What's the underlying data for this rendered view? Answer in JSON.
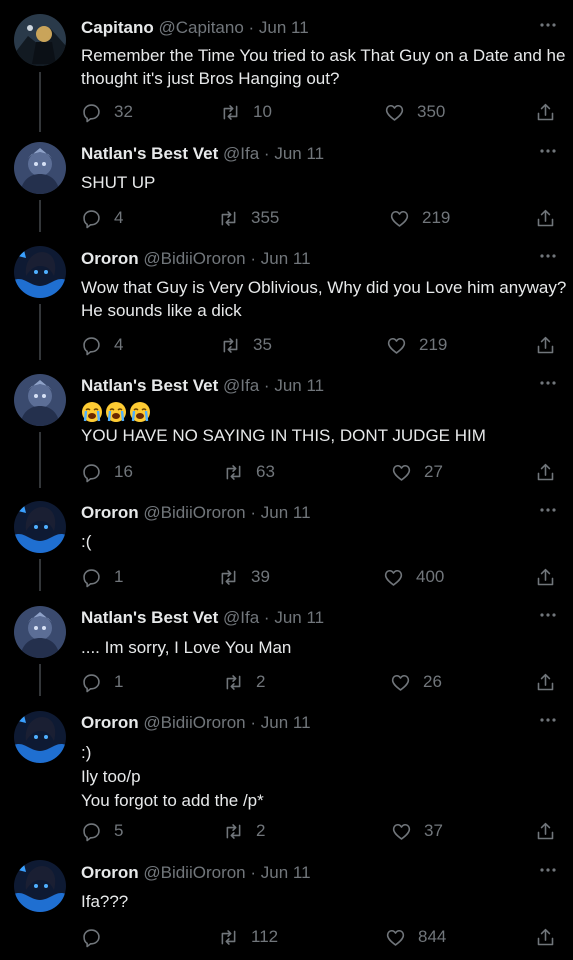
{
  "colors": {
    "background": "#000000",
    "text": "#e7e9ea",
    "muted": "#71767b",
    "thread_line": "#333639"
  },
  "icons": {
    "reply": "reply-icon",
    "retweet": "retweet-icon",
    "like": "heart-icon",
    "share": "share-icon",
    "more": "more-dots-icon"
  },
  "tweets": [
    {
      "name": "Capitano",
      "handle": "@Capitano",
      "dot": "·",
      "date": "Jun 11",
      "lines": [
        "Remember the Time You tried to ask That Guy on a Date and he",
        "thought it's just Bros Hanging out?"
      ],
      "replies": "32",
      "retweets": "10",
      "likes": "350",
      "avatar": "capitano"
    },
    {
      "name": "Natlan's Best Vet",
      "handle": "@Ifa",
      "dot": "·",
      "date": "Jun 11",
      "lines": [
        "SHUT UP"
      ],
      "replies": "4",
      "retweets": "355",
      "likes": "219",
      "avatar": "ifa"
    },
    {
      "name": "Ororon",
      "handle": "@BidiiOroron",
      "dot": "·",
      "date": "Jun 11",
      "lines": [
        "Wow that Guy is Very Oblivious, Why did you Love him anyway?",
        "He sounds like a dick"
      ],
      "replies": "4",
      "retweets": "35",
      "likes": "219",
      "avatar": "ororon"
    },
    {
      "name": "Natlan's Best Vet",
      "handle": "@Ifa",
      "dot": "·",
      "date": "Jun 11",
      "emoji": [
        "loudly-crying-face",
        "loudly-crying-face",
        "loudly-crying-face"
      ],
      "lines": [
        "YOU HAVE NO SAYING IN THIS, DONT JUDGE HIM"
      ],
      "replies": "16",
      "retweets": "63",
      "likes": "27",
      "avatar": "ifa"
    },
    {
      "name": "Ororon",
      "handle": "@BidiiOroron",
      "dot": "·",
      "date": "Jun 11",
      "lines": [
        ":("
      ],
      "replies": "1",
      "retweets": "39",
      "likes": "400",
      "avatar": "ororon"
    },
    {
      "name": "Natlan's Best Vet",
      "handle": "@Ifa",
      "dot": "·",
      "date": "Jun 11",
      "lines": [
        ".... Im sorry, I Love You Man"
      ],
      "replies": "1",
      "retweets": "2",
      "likes": "26",
      "avatar": "ifa"
    },
    {
      "name": "Ororon",
      "handle": "@BidiiOroron",
      "dot": "·",
      "date": "Jun 11",
      "lines": [
        ":)",
        "Ily too/p",
        "You forgot to add the /p*"
      ],
      "replies": "5",
      "retweets": "2",
      "likes": "37",
      "avatar": "ororon"
    },
    {
      "name": "Ororon",
      "handle": "@BidiiOroron",
      "dot": "·",
      "date": "Jun 11",
      "lines": [
        "Ifa???"
      ],
      "replies": "",
      "retweets": "112",
      "likes": "844",
      "avatar": "ororon"
    }
  ]
}
